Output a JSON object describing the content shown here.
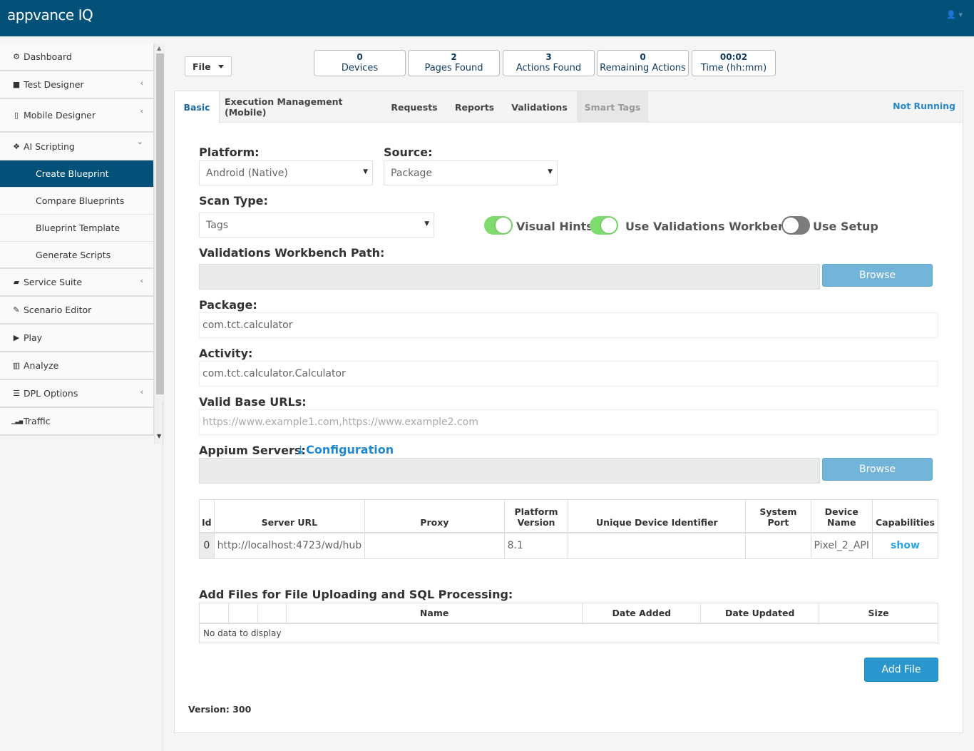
{
  "app": {
    "title": "appvance IQ"
  },
  "header": {
    "user_menu": "👤 ▾"
  },
  "sidebar": {
    "items": [
      {
        "icon": "dashboard-icon",
        "glyph": "⚙",
        "label": "Dashboard"
      },
      {
        "icon": "video-icon",
        "glyph": "■",
        "label": "Test Designer"
      },
      {
        "icon": "mobile-icon",
        "glyph": "▯",
        "label": "Mobile Designer"
      },
      {
        "icon": "cubes-icon",
        "glyph": "❖",
        "label": "AI Scripting"
      }
    ],
    "sub_items": [
      "Create Blueprint",
      "Compare Blueprints",
      "Blueprint Template",
      "Generate Scripts"
    ],
    "items2": [
      {
        "icon": "briefcase-icon",
        "glyph": "▰",
        "label": "Service Suite"
      },
      {
        "icon": "wrench-icon",
        "glyph": "✎",
        "label": "Scenario Editor"
      },
      {
        "icon": "play-icon",
        "glyph": "▶",
        "label": "Play"
      },
      {
        "icon": "bar-chart-icon",
        "glyph": "▥",
        "label": "Analyze"
      },
      {
        "icon": "list-icon",
        "glyph": "☰",
        "label": "DPL Options"
      },
      {
        "icon": "signal-icon",
        "glyph": "▁▃▅",
        "label": "Traffic"
      }
    ],
    "chev_left": "‹",
    "chev_down": "⌄"
  },
  "toolbar": {
    "file_label": "File"
  },
  "stats": [
    {
      "value": "0",
      "label": "Devices"
    },
    {
      "value": "2",
      "label": "Pages Found"
    },
    {
      "value": "3",
      "label": "Actions Found"
    },
    {
      "value": "0",
      "label": "Remaining Actions"
    },
    {
      "value": "00:02",
      "label": "Time (hh:mm)"
    }
  ],
  "tabs": [
    "Basic",
    "Execution Management (Mobile)",
    "Requests",
    "Reports",
    "Validations",
    "Smart Tags"
  ],
  "status": "Not Running",
  "form": {
    "platform_label": "Platform:",
    "platform_value": "Android (Native)",
    "source_label": "Source:",
    "source_value": "Package",
    "scan_label": "Scan Type:",
    "scan_value": "Tags",
    "toggles": [
      {
        "label": "Visual Hints",
        "on": true
      },
      {
        "label": "Use Validations Workbench",
        "on": true
      },
      {
        "label": "Use Setup",
        "on": false
      }
    ],
    "workbench_label": "Validations Workbench Path:",
    "workbench_value": "",
    "browse_label": "Browse",
    "package_label": "Package:",
    "package_value": "com.tct.calculator",
    "activity_label": "Activity:",
    "activity_value": "com.tct.calculator.Calculator",
    "urls_label": "Valid Base URLs:",
    "urls_placeholder": "https://www.example1.com,https://www.example2.com",
    "appium_label": "Appium Servers:",
    "config_label": "Configuration",
    "config_icon": "⤓",
    "appium_value": "",
    "select_arrow": "▼"
  },
  "servers_table": {
    "headers": [
      "Id",
      "Server URL",
      "Proxy",
      "Platform Version",
      "Unique Device Identifier",
      "System Port",
      "Device Name",
      "Capabilities"
    ],
    "rows": [
      {
        "id": "0",
        "url": "http://localhost:4723/wd/hub",
        "proxy": "",
        "version": "8.1",
        "udid": "",
        "port": "",
        "device": "Pixel_2_API",
        "cap": "show"
      }
    ]
  },
  "files": {
    "title": "Add Files for File Uploading and SQL Processing:",
    "headers": [
      "",
      "",
      "",
      "Name",
      "Date Added",
      "Date Updated",
      "Size"
    ],
    "empty": "No data to display",
    "add_label": "Add File"
  },
  "version": "Version: 300",
  "colors": {
    "header": "#035078",
    "active": "#035078",
    "accent": "#2a97cf",
    "toggle_on": "#7ddc6d"
  }
}
